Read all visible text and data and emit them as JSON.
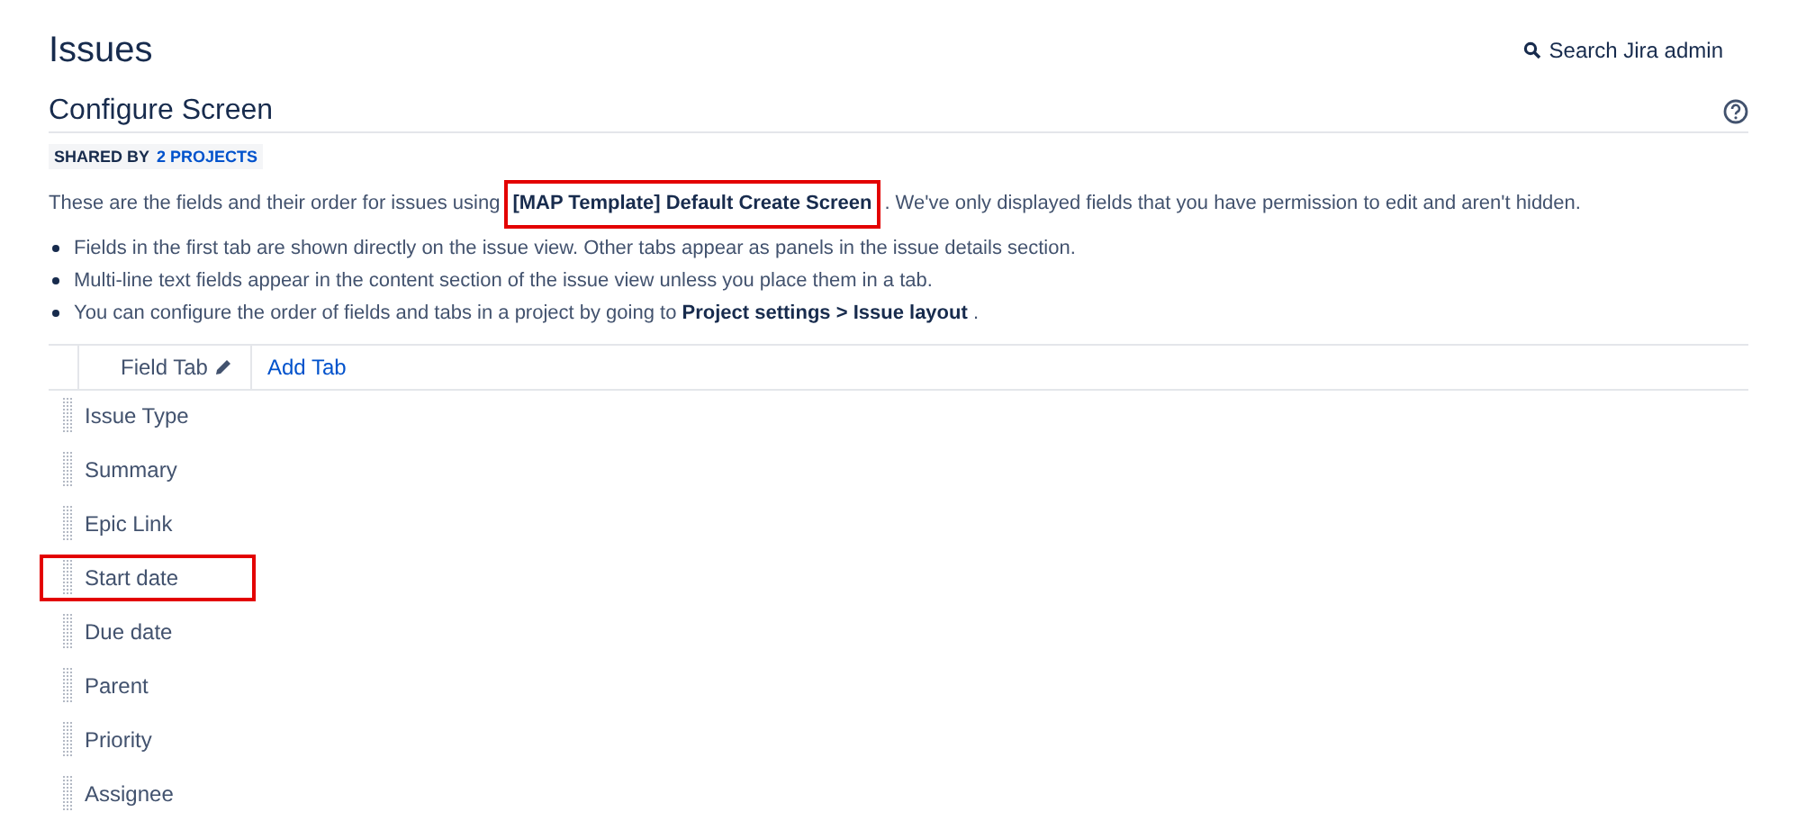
{
  "page_title": "Issues",
  "search": {
    "label": "Search Jira admin"
  },
  "screen": {
    "title": "Configure Screen",
    "shared_prefix": "SHARED BY",
    "shared_link": "2 PROJECTS",
    "intro_before": "These are the fields and their order for issues using",
    "screen_name": {
      "text": "[MAP Template] Default Create Screen",
      "highlighted": true
    },
    "intro_after": ". We've only displayed fields that you have permission to edit and aren't hidden.",
    "notes": [
      "Fields in the first tab are shown directly on the issue view. Other tabs appear as panels in the issue details section.",
      "Multi-line text fields appear in the content section of the issue view unless you place them in a tab.",
      "You can configure the order of fields and tabs in a project by going to **Project settings > Issue layout** ."
    ]
  },
  "tabs": [
    {
      "label": "Field Tab",
      "selected": true
    }
  ],
  "add_tab": "Add Tab",
  "fields": [
    {
      "name": "Issue Type",
      "highlighted": false
    },
    {
      "name": "Summary",
      "highlighted": false
    },
    {
      "name": "Epic Link",
      "highlighted": false
    },
    {
      "name": "Start date",
      "highlighted": true
    },
    {
      "name": "Due date",
      "highlighted": false
    },
    {
      "name": "Parent",
      "highlighted": false
    },
    {
      "name": "Priority",
      "highlighted": false
    },
    {
      "name": "Assignee",
      "highlighted": false
    }
  ]
}
